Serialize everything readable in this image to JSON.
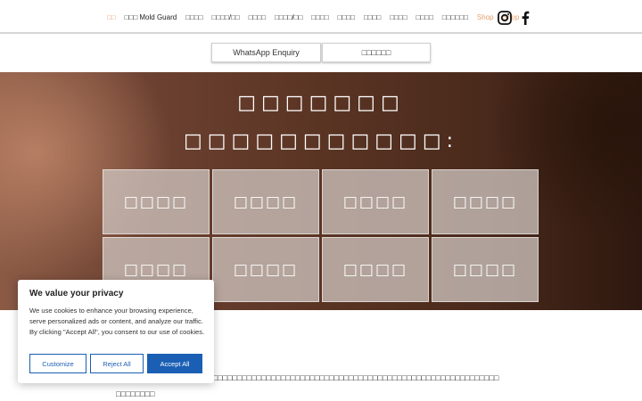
{
  "nav": {
    "items": [
      {
        "label": "□□",
        "state": "active"
      },
      {
        "label": "□□□ Mold Guard",
        "state": ""
      },
      {
        "label": "□□□□",
        "state": ""
      },
      {
        "label": "□□□□/□□",
        "state": ""
      },
      {
        "label": "□□□□",
        "state": ""
      },
      {
        "label": "□□□□/□□",
        "state": ""
      },
      {
        "label": "□□□□",
        "state": ""
      },
      {
        "label": "□□□□",
        "state": ""
      },
      {
        "label": "□□□□",
        "state": ""
      },
      {
        "label": "□□□□",
        "state": ""
      },
      {
        "label": "□□□□",
        "state": ""
      },
      {
        "label": "□□□□□□",
        "state": ""
      },
      {
        "label": "Shop",
        "state": "shop"
      },
      {
        "label": "Shop",
        "state": "shop"
      }
    ],
    "social": [
      "instagram-icon",
      "facebook-icon"
    ]
  },
  "subnav": {
    "whatsapp": "WhatsApp Enquiry",
    "other": "□□□□□□"
  },
  "hero": {
    "line1": "□□□□□□□",
    "line2": "□□□□□□□□□□□:",
    "tiles": [
      "□□□□",
      "□□□□",
      "□□□□",
      "□□□□",
      "□□□□",
      "□□□□",
      "□□□□",
      "□□□□"
    ]
  },
  "body": {
    "line1": "□□□□□□□□□□□□□□□□□□□□□□□□□□□□□□□□□□□□□□□□□□□□□□□□□□□□□□□□□□□□□□□□□□□□□□□□□□□□□□□",
    "line2": "□□□□□□□□"
  },
  "cookie": {
    "title": "We value your privacy",
    "text": "We use cookies to enhance your browsing experience, serve personalized ads or content, and analyze our traffic. By clicking \"Accept All\", you consent to our use of cookies.",
    "customize": "Customize",
    "reject": "Reject All",
    "accept": "Accept All",
    "accent_color": "#1a5fb4"
  }
}
